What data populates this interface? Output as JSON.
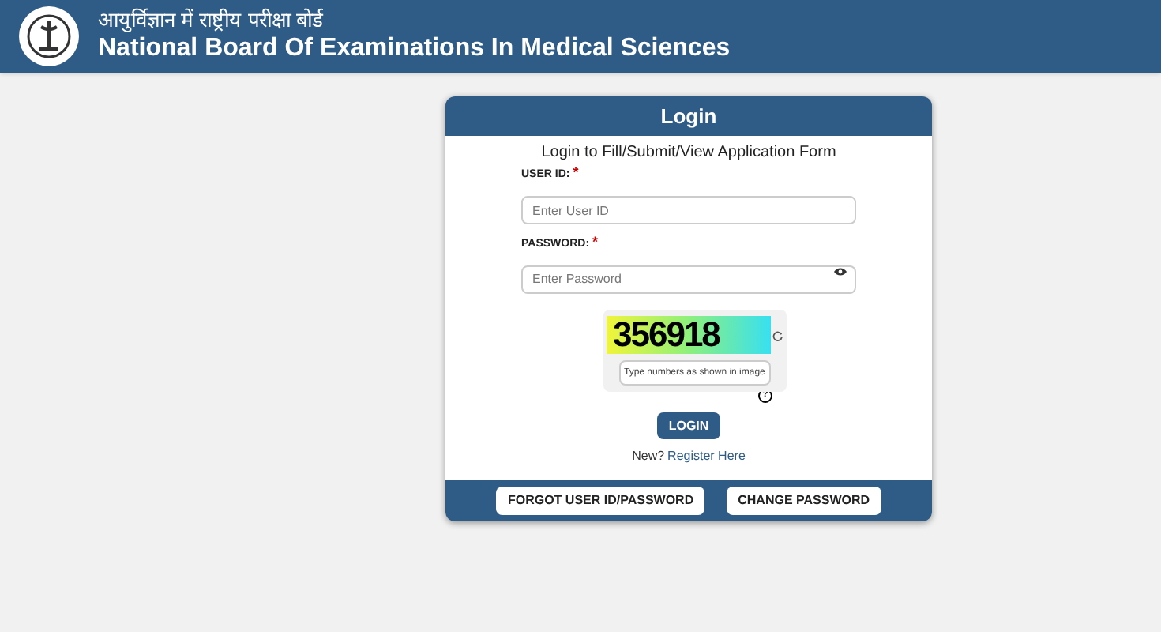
{
  "header": {
    "title_hindi": "आयुर्विज्ञान में राष्ट्रीय परीक्षा बोर्ड",
    "title": "National Board Of Examinations In Medical Sciences"
  },
  "login": {
    "title": "Login",
    "subtitle": "Login to Fill/Submit/View Application Form",
    "fields": [
      {
        "kind": "text",
        "label": "USER ID:",
        "required_mark": "*",
        "placeholder": "Enter User ID"
      },
      {
        "kind": "password",
        "label": "PASSWORD:",
        "required_mark": "*",
        "placeholder": "Enter Password"
      }
    ],
    "captcha": {
      "code": "356918",
      "placeholder": "Type numbers as shown in image",
      "help": "?"
    },
    "login_button": "LOGIN",
    "register_prompt": "New?",
    "register_link": "Register Here",
    "footer_buttons": [
      "FORGOT USER ID/PASSWORD",
      "CHANGE PASSWORD"
    ]
  }
}
